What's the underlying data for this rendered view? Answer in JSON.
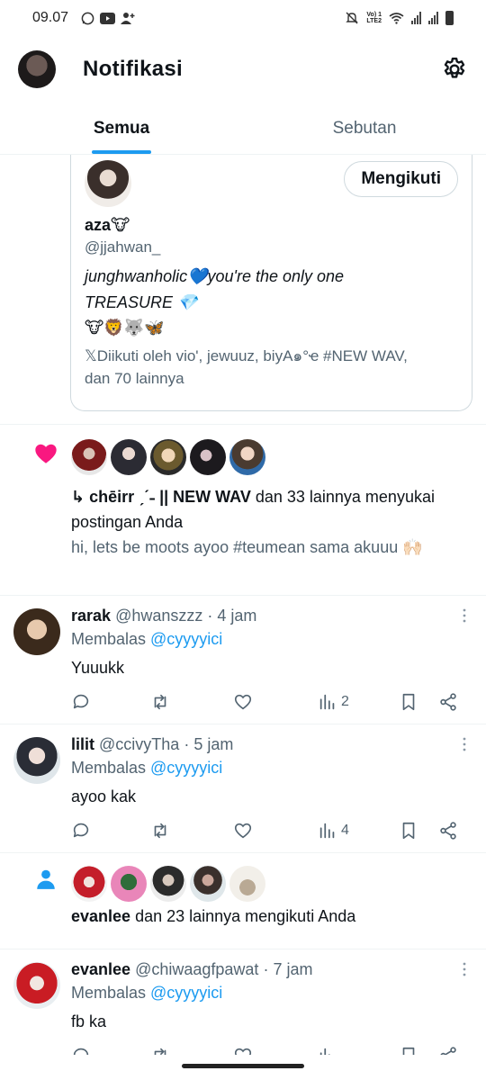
{
  "status_bar": {
    "time": "09.07",
    "lte_top": "Vo) 1",
    "lte_bottom": "LTE2",
    "icons": [
      "whatsapp-icon",
      "youtube-icon",
      "person-add-icon",
      "mute-icon",
      "wifi-icon",
      "signal-icon",
      "battery-icon"
    ]
  },
  "header": {
    "title": "Notifikasi"
  },
  "tabs": [
    {
      "label": "Semua",
      "active": true
    },
    {
      "label": "Sebutan",
      "active": false
    }
  ],
  "user_card": {
    "follow_label": "Mengikuti",
    "name": "aza🐮",
    "handle": "@jjahwan_",
    "bio_line1": "junghwanholic💙you're the only one",
    "bio_line2": "TREASURE 💎",
    "emoji_line": "🐮🦁🐺🦋",
    "followed_by": "𝕏Diikuti oleh vio', jewuuz, biyA๑°ҽ #NEW WAV, dan 70 lainnya"
  },
  "like_notification": {
    "actor": "↳ chēirr ˏˊ˗ || NEW WAV",
    "text": " dan 33 lainnya menyukai postingan Anda",
    "snippet": "hi, lets be moots ayoo #teumean sama akuuu 🙌🏻"
  },
  "replies": [
    {
      "name": "rarak",
      "handle": "@hwanszzz",
      "time": "· 4 jam",
      "reply_prefix": "Membalas ",
      "mention": "@cyyyyici",
      "body": "Yuuukk",
      "views": "2"
    },
    {
      "name": "lilit",
      "handle": "@ccivyTha",
      "time": "· 5 jam",
      "reply_prefix": "Membalas ",
      "mention": "@cyyyyici",
      "body": "ayoo kak",
      "views": "4"
    },
    {
      "name": "evanlee",
      "handle": "@chiwaagfpawat",
      "time": "· 7 jam",
      "reply_prefix": "Membalas ",
      "mention": "@cyyyyici",
      "body": "fb ka",
      "views": ""
    }
  ],
  "follow_notification": {
    "actor": "evanlee",
    "text": " dan 23 lainnya mengikuti Anda"
  },
  "colors": {
    "accent": "#1d9bf0",
    "like": "#f91880",
    "text": "#0f1419",
    "muted": "#536471"
  }
}
